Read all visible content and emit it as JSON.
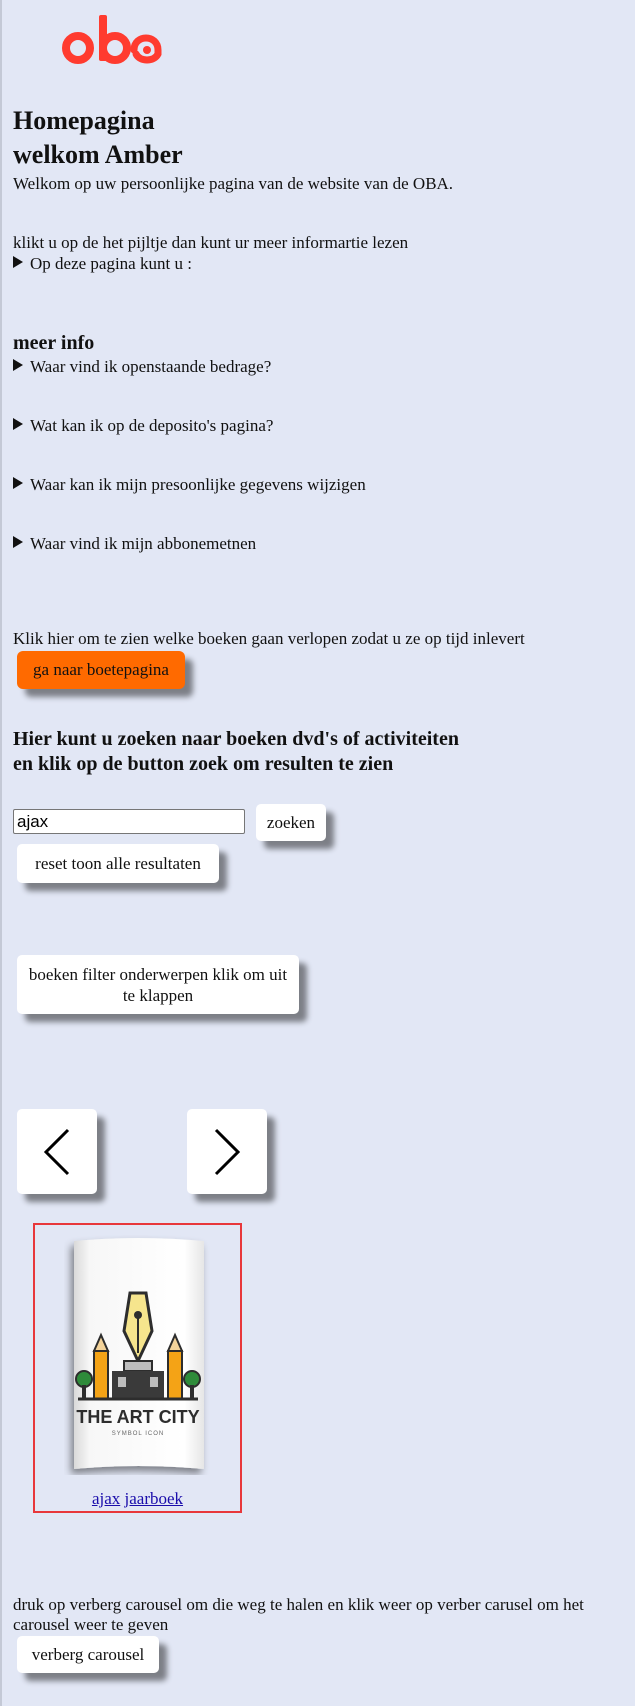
{
  "brand": {
    "logo_text": "oba",
    "color": "#ff3b2f"
  },
  "header": {
    "title": "Homepagina",
    "welcome": "welkom Amber",
    "intro": "Welkom op uw persoonlijke pagina van de website van de OBA."
  },
  "info": {
    "instruction": "klikt u op de het pijltje dan kunt ur meer informartie lezen",
    "summary": "Op deze pagina kunt u :"
  },
  "faq": {
    "heading": "meer info",
    "items": [
      "Waar vind ik openstaande bedrage?",
      "Wat kan ik op de deposito's pagina?",
      "Waar kan ik mijn presoonlijke gegevens wijzigen",
      "Waar vind ik mijn abbonemetnen"
    ]
  },
  "fines": {
    "text": "Klik hier om te zien welke boeken gaan verlopen zodat u ze op tijd inlevert",
    "button_label": "ga naar boetepagina",
    "button_color": "#ff6a00"
  },
  "search": {
    "heading": "Hier kunt u zoeken naar boeken dvd's of activiteiten en klik op de button zoek om resulten te zien",
    "value": "ajax",
    "button_label": "zoeken",
    "reset_label": "reset toon alle resultaten"
  },
  "filter": {
    "button_label": "boeken filter onderwerpen klik om uit te klappen"
  },
  "carousel": {
    "prev_icon": "chevron-left-icon",
    "next_icon": "chevron-right-icon",
    "book": {
      "cover_title": "THE ART CITY",
      "cover_subtitle": "SYMBOL ICON",
      "link_words": [
        "ajax",
        "jaarboek"
      ]
    },
    "highlight_color": "#e8373b"
  },
  "footer": {
    "text_line1": "druk op verberg carousel om die weg te halen en klik weer op verber carusel om het",
    "text_line2": "carousel weer te geven",
    "button_label": "verberg carousel"
  }
}
